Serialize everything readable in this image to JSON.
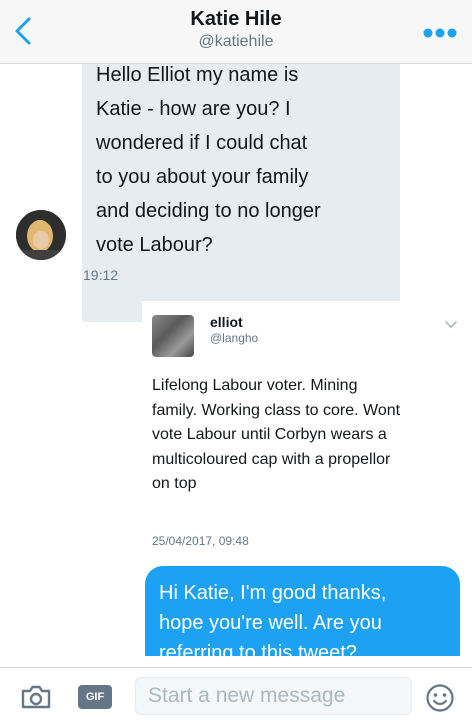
{
  "header": {
    "title": "Katie Hile",
    "handle": "@katiehile",
    "back_icon": "chevron-left-icon",
    "more_icon": "ellipsis-icon"
  },
  "messages": {
    "incoming": {
      "text": "Hello Elliot my name is\nKatie - how are you? I\nwondered if I could chat\nto you about your family\nand deciding to no longer\nvote Labour?",
      "time": "19:12"
    },
    "quoted_tweet": {
      "name": "elliot",
      "handle": "@langho",
      "text": "Lifelong Labour voter. Mining\nfamily. Working class to core. Wont\nvote Labour until Corbyn wears a\nmulticoloured cap with a propellor\non top",
      "date": "25/04/2017, 09:48"
    },
    "outgoing": {
      "text": "Hi Katie, I'm good thanks,\nhope you're well. Are you\nreferring to this tweet?"
    }
  },
  "composer": {
    "placeholder": "Start a new message",
    "value": "",
    "gif_label": "GIF",
    "camera_icon": "camera-icon",
    "emoji_icon": "emoji-icon"
  },
  "colors": {
    "accent": "#1da1f2",
    "incoming_bubble": "#e6ecf0",
    "secondary_text": "#657786"
  }
}
